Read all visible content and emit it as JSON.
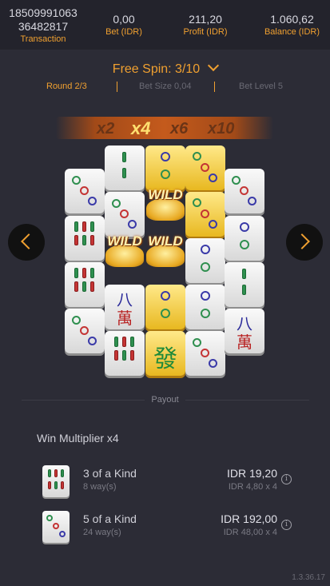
{
  "topbar": {
    "transaction_line1": "18509991063",
    "transaction_line2": "36482817",
    "transaction_label": "Transaction",
    "bet_value": "0,00",
    "bet_label": "Bet (IDR)",
    "profit_value": "211,20",
    "profit_label": "Profit (IDR)",
    "balance_value": "1.060,62",
    "balance_label": "Balance (IDR)"
  },
  "spin": {
    "title": "Free Spin: 3/10"
  },
  "info": {
    "round": "Round 2/3",
    "bet_size": "Bet Size 0,04",
    "bet_level": "Bet Level 5"
  },
  "multipliers": [
    "x2",
    "x4",
    "x6",
    "x10"
  ],
  "active_multiplier": "x4",
  "wild_text": "WILD",
  "payout": {
    "label": "Payout",
    "win_multiplier": "Win Multiplier x4",
    "rows": [
      {
        "name": "3 of a Kind",
        "ways": "8 way(s)",
        "amount": "IDR 19,20",
        "calc": "IDR 4,80 x 4"
      },
      {
        "name": "5 of a Kind",
        "ways": "24 way(s)",
        "amount": "IDR 192,00",
        "calc": "IDR 48,00 x 4"
      }
    ]
  },
  "colors": {
    "accent": "#f0a030",
    "background": "#2c2c36",
    "topbar": "#23232c"
  },
  "version": "1.3.36.17"
}
